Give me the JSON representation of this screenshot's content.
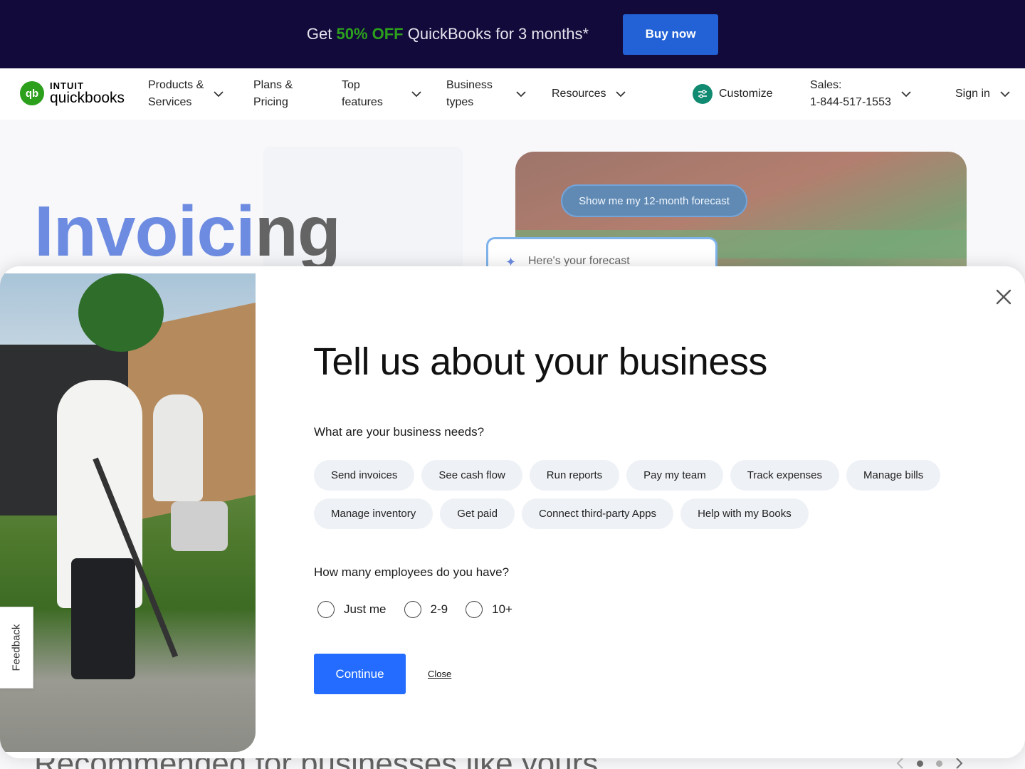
{
  "promo": {
    "prefix": "Get ",
    "highlight": "50% OFF",
    "suffix": " QuickBooks for 3 months*",
    "button": "Buy now",
    "accent_color": "#2ca01c"
  },
  "nav": {
    "logo_top": "INTUIT",
    "logo_bottom": "quickbooks",
    "items": [
      {
        "line1": "Products &",
        "line2": "Services"
      },
      {
        "line1": "Plans &",
        "line2": "Pricing"
      },
      {
        "line1": "Top",
        "line2": "features"
      },
      {
        "line1": "Business",
        "line2": "types"
      },
      {
        "line1": "Resources",
        "line2": ""
      }
    ],
    "customize": "Customize",
    "sales_label": "Sales:",
    "sales_phone": "1-844-517-1553",
    "sign_in": "Sign in"
  },
  "hero": {
    "title_blue": "Invoici",
    "title_dark": "ng",
    "forecast_button": "Show me my 12-month forecast",
    "forecast_card": "Here's your forecast",
    "recommended": "Recommended for businesses like yours"
  },
  "modal": {
    "title": "Tell us about your business",
    "needs_question": "What are your business needs?",
    "needs": [
      "Send invoices",
      "See cash flow",
      "Run reports",
      "Pay my team",
      "Track expenses",
      "Manage bills",
      "Manage inventory",
      "Get paid",
      "Connect third-party Apps",
      "Help with my Books"
    ],
    "employees_question": "How many employees do you have?",
    "employee_options": [
      "Just me",
      "2-9",
      "10+"
    ],
    "continue": "Continue",
    "close": "Close"
  },
  "feedback": "Feedback",
  "colors": {
    "brand_blue": "#236cff",
    "banner_bg": "#120a3a",
    "brand_green": "#2ca01c"
  }
}
